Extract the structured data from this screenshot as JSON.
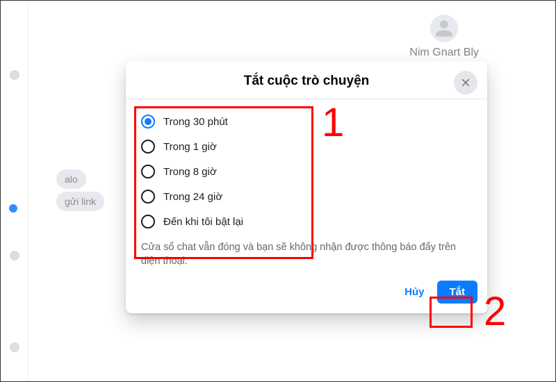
{
  "header": {
    "username": "Nim Gnart Bly"
  },
  "chat": {
    "bubble1": "alo",
    "bubble2": "gửi link"
  },
  "modal": {
    "title": "Tắt cuộc trò chuyện",
    "options": [
      {
        "label": "Trong 30 phút",
        "selected": true
      },
      {
        "label": "Trong 1 giờ",
        "selected": false
      },
      {
        "label": "Trong 8 giờ",
        "selected": false
      },
      {
        "label": "Trong 24 giờ",
        "selected": false
      },
      {
        "label": "Đến khi tôi bật lại",
        "selected": false
      }
    ],
    "helper": "Cửa sổ chat vẫn đóng và bạn sẽ không nhận được thông báo đẩy trên điện thoại.",
    "cancel_label": "Hủy",
    "confirm_label": "Tắt"
  },
  "annotations": {
    "num1": "1",
    "num2": "2"
  }
}
